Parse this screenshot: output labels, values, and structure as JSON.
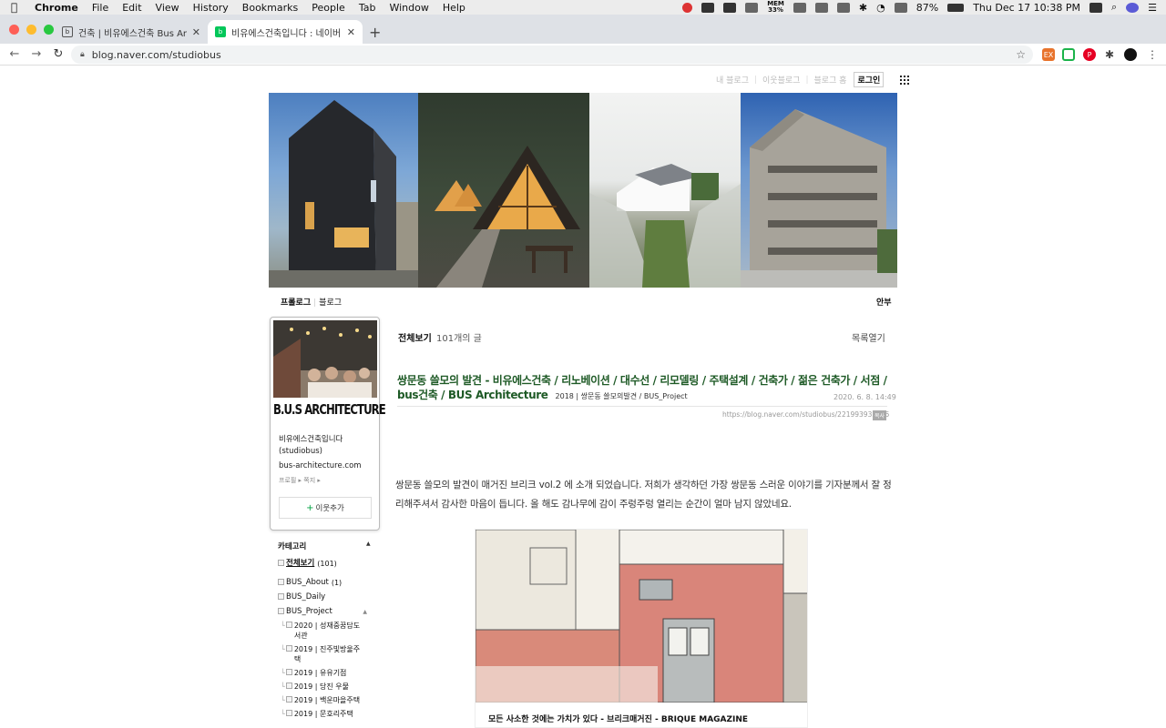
{
  "menubar": {
    "app_name": "Chrome",
    "menus": [
      "File",
      "Edit",
      "View",
      "History",
      "Bookmarks",
      "People",
      "Tab",
      "Window",
      "Help"
    ],
    "mem_label": "MEM",
    "mem_value": "33%",
    "battery": "87%",
    "clock": "Thu Dec 17  10:38 PM"
  },
  "tabs": [
    {
      "title": "건축 | 비유에스건축 Bus Architect",
      "favicon": "b.u.s-favicon"
    },
    {
      "title": "비유에스건축입니다 : 네이버 블로그",
      "favicon": "naver-blog-favicon",
      "active": true
    }
  ],
  "toolbar": {
    "url": "blog.naver.com/studiobus"
  },
  "gnb": {
    "my_blog": "내 블로그",
    "neighbor_blog": "이웃블로그",
    "blog_home": "블로그 홈",
    "login": "로그인"
  },
  "blog_menu": {
    "prologue": "프롤로그",
    "blog": "블로그",
    "guestbook": "안부"
  },
  "profile": {
    "logo": "B.U.S ARCHITECTURE",
    "name": "비유에스건축입니다",
    "id": "(studiobus)",
    "url": "bus-architecture.com",
    "links": "프로필 ▸ 쪽지 ▸",
    "add_neighbor": "이웃추가"
  },
  "category": {
    "title": "카테고리",
    "items": [
      {
        "label": "전체보기",
        "count": "(101)",
        "level": 0,
        "bold": true
      },
      {
        "label": "BUS_About",
        "count": "(1)",
        "level": 0
      },
      {
        "label": "BUS_Daily",
        "count": "",
        "level": 0
      },
      {
        "label": "BUS_Project",
        "count": "",
        "level": 0
      },
      {
        "label": "2020 | 성재중꿈담도서관",
        "count": "",
        "level": 1
      },
      {
        "label": "2019 | 진주빛방울주택",
        "count": "",
        "level": 1
      },
      {
        "label": "2019 | 유유기점",
        "count": "",
        "level": 1
      },
      {
        "label": "2019 | 당진 우물",
        "count": "",
        "level": 1
      },
      {
        "label": "2019 | 백운마을주택",
        "count": "",
        "level": 1
      },
      {
        "label": "2019 | 문호리주택",
        "count": "",
        "level": 1
      }
    ]
  },
  "post_list": {
    "all_label": "전체보기",
    "count_label": "101개의 글",
    "open_list": "목록열기"
  },
  "post": {
    "title": "쌍문동 쓸모의 발견 - 비유에스건축 / 리노베이션 / 대수선 / 리모델링 / 주택설계 / 건축가 / 젊은 건축가 / 서점 / bus건축 / BUS Architecture",
    "category": "2018 | 쌍문동 쓸모의발견 / BUS_Project",
    "date": "2020. 6. 8. 14:49",
    "url": "https://blog.naver.com/studiobus/221993932485",
    "copy_label": "복사",
    "body": "쌍문동 쓸모의 발견이 매거진 브리크 vol.2 에 소개 되었습니다. 저희가 생각하던 가장 쌍문동 스러운 이야기를 기자분께서 잘 정리해주셔서 감사한 마음이 듭니다. 올 해도 감나무에 감이 주렁주렁 열리는 순간이 얼마 남지 않았네요.",
    "image_caption": "모든 사소한 것에는 가치가 있다 - 브리크매거진 - BRIQUE MAGAZINE"
  },
  "colors": {
    "naver_green": "#03c75a",
    "title_green": "#1e5a26"
  }
}
